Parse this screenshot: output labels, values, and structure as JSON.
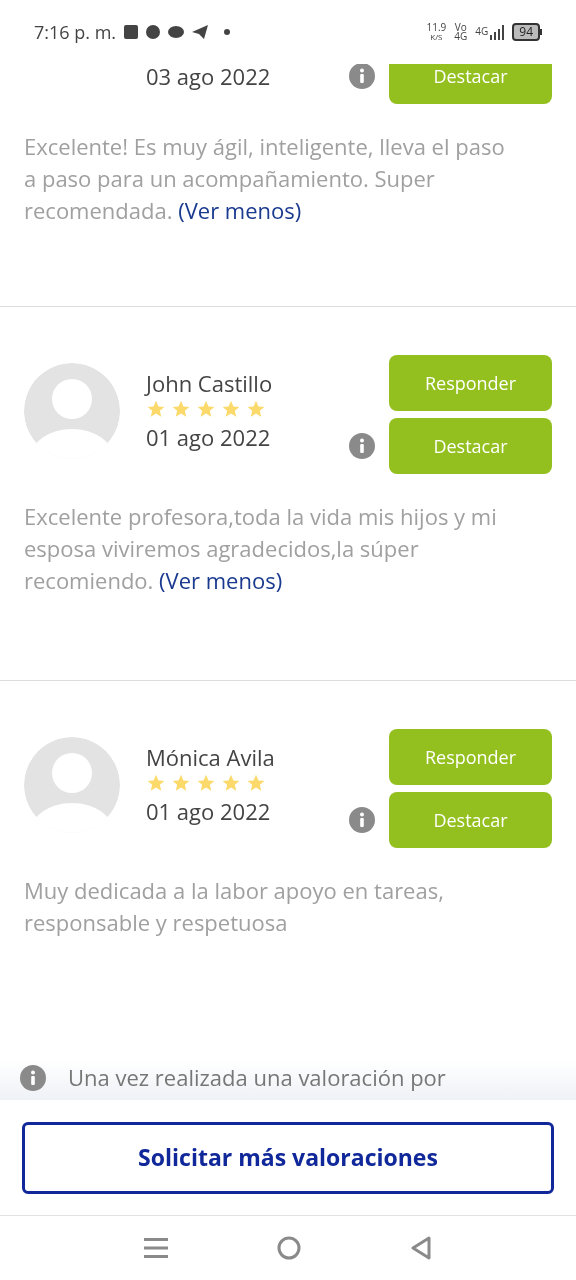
{
  "status_bar": {
    "time": "7:16 p. m.",
    "speed": "11.9",
    "speed_unit": "K/S",
    "network_top": "Vo",
    "network_bottom": "4G",
    "signal_label": "4G",
    "battery": "94"
  },
  "reviews": [
    {
      "cut": true,
      "date": "03 ago 2022",
      "comment": "Excelente! Es muy ágil, inteligente, lleva el paso a paso para un acompañamiento. Super recomendada.",
      "toggle": "(Ver menos)",
      "highlight_button": "Destacar"
    },
    {
      "cut": false,
      "name": "John Castillo",
      "stars": 5,
      "date": "01 ago 2022",
      "comment": "Excelente profesora,toda la vida mis hijos y mi esposa viviremos agradecidos,la súper recomiendo.",
      "toggle": "(Ver menos)",
      "reply_button": "Responder",
      "highlight_button": "Destacar"
    },
    {
      "cut": false,
      "name": "Mónica Avila",
      "stars": 5,
      "date": "01 ago 2022",
      "comment": "Muy dedicada a la labor apoyo en tareas, responsable y respetuosa",
      "reply_button": "Responder",
      "highlight_button": "Destacar"
    }
  ],
  "note": "Una vez realizada una valoración por",
  "request_button": "Solicitar más valoraciones"
}
